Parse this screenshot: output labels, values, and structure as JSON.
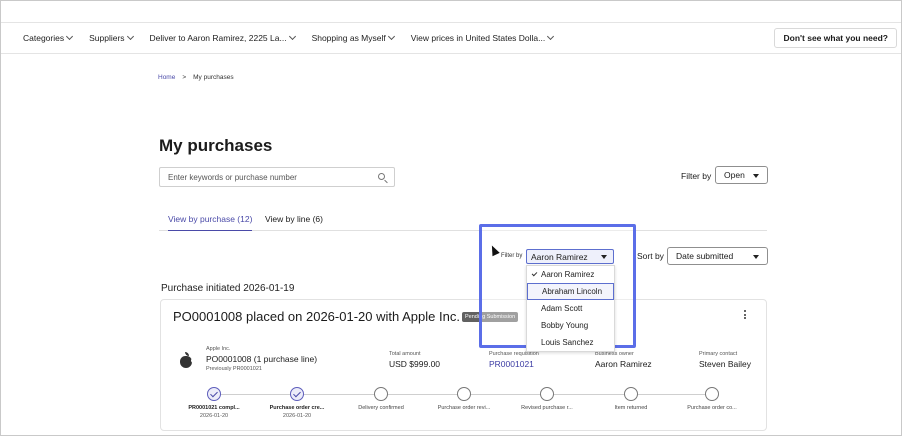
{
  "nav": {
    "items": [
      {
        "label": "Categories"
      },
      {
        "label": "Suppliers"
      },
      {
        "label": "Deliver to Aaron Ramirez, 2225 La..."
      },
      {
        "label": "Shopping as Myself"
      },
      {
        "label": "View prices in United States Dolla..."
      }
    ],
    "help_label": "Don't see what you need?"
  },
  "breadcrumb": {
    "home": "Home",
    "separator": ">",
    "current": "My purchases"
  },
  "page": {
    "title": "My purchases"
  },
  "search": {
    "placeholder": "Enter keywords or purchase number"
  },
  "filter": {
    "label": "Filter by",
    "value": "Open"
  },
  "tabs": [
    {
      "label": "View by purchase (12)",
      "active": true
    },
    {
      "label": "View by line (6)",
      "active": false
    }
  ],
  "owner_filter": {
    "label": "Filter by",
    "selected": "Aaron Ramirez",
    "options": [
      {
        "label": "Aaron Ramirez",
        "checked": true
      },
      {
        "label": "Abraham Lincoln",
        "hovered": true
      },
      {
        "label": "Adam Scott"
      },
      {
        "label": "Bobby Young"
      },
      {
        "label": "Louis Sanchez"
      }
    ]
  },
  "sort": {
    "label": "Sort by",
    "value": "Date submitted"
  },
  "group": {
    "title": "Purchase initiated 2026-01-19"
  },
  "card": {
    "title": "PO0001008 placed on 2026-01-20 with Apple Inc.",
    "badge": "Pending Submission",
    "supplier": "Apple Inc.",
    "po": "PO0001008 (1 purchase line)",
    "previously": "Previously PR0001021",
    "total_label": "Total amount",
    "total_value": "USD $999.00",
    "req_label": "Purchase requisition",
    "req_value": "PR0001021",
    "owner_label": "Business owner",
    "owner_value": "Aaron Ramirez",
    "contact_label": "Primary contact",
    "contact_value": "Steven Bailey"
  },
  "timeline": [
    {
      "label": "PR0001021 compl...",
      "date": "2026-01-20",
      "done": true
    },
    {
      "label": "Purchase order cre...",
      "date": "2026-01-20",
      "done": true
    },
    {
      "label": "Delivery confirmed",
      "date": "",
      "done": false
    },
    {
      "label": "Purchase order revi...",
      "date": "",
      "done": false
    },
    {
      "label": "Revised purchase r...",
      "date": "",
      "done": false
    },
    {
      "label": "Item returned",
      "date": "",
      "done": false
    },
    {
      "label": "Purchase order co...",
      "date": "",
      "done": false
    }
  ],
  "colors": {
    "accent": "#4a4aa8",
    "highlight": "#5b6ee8",
    "badge": "#616161"
  }
}
